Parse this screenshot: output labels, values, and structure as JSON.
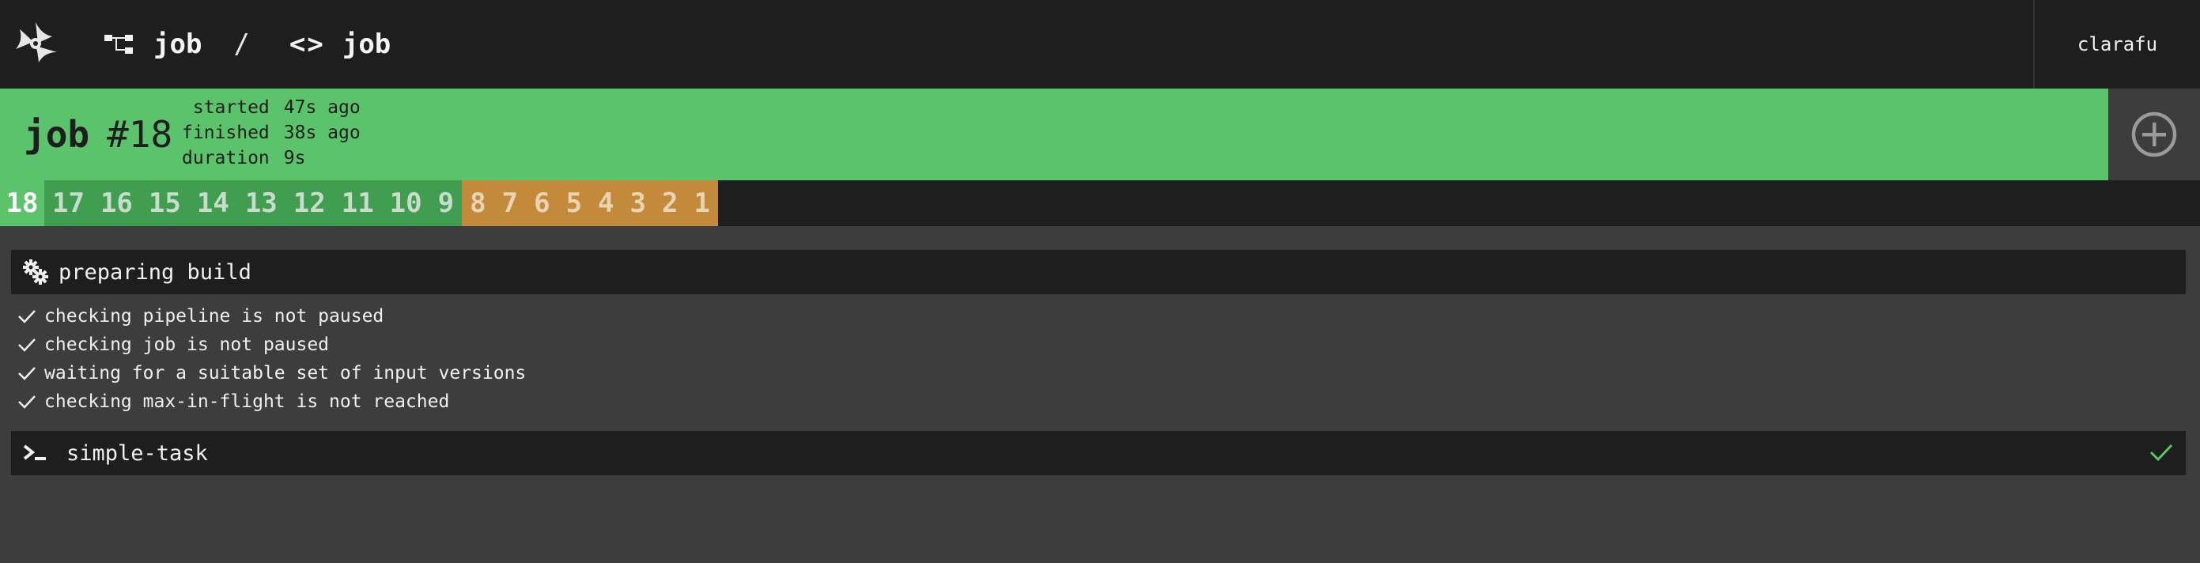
{
  "topbar": {
    "pipeline_name": "job",
    "separator": "/",
    "job_icon": "<>",
    "job_name": "job",
    "user": "clarafu",
    "icons": {
      "logo": "concourse-logo-icon",
      "pipeline": "pipeline-icon",
      "job": "code-brackets-icon"
    }
  },
  "build": {
    "job_name": "job",
    "number": "#18",
    "status": "succeeded",
    "times": [
      {
        "label": "started",
        "value": "47s ago"
      },
      {
        "label": "finished",
        "value": "38s ago"
      },
      {
        "label": "duration",
        "value": "9s"
      }
    ],
    "trigger_icon": "add-circle-icon"
  },
  "build_tabs": [
    {
      "label": "18",
      "status": "current"
    },
    {
      "label": "17",
      "status": "succeeded"
    },
    {
      "label": "16",
      "status": "succeeded"
    },
    {
      "label": "15",
      "status": "succeeded"
    },
    {
      "label": "14",
      "status": "succeeded"
    },
    {
      "label": "13",
      "status": "succeeded"
    },
    {
      "label": "12",
      "status": "succeeded"
    },
    {
      "label": "11",
      "status": "succeeded"
    },
    {
      "label": "10",
      "status": "succeeded"
    },
    {
      "label": "9",
      "status": "succeeded"
    },
    {
      "label": "8",
      "status": "errored"
    },
    {
      "label": "7",
      "status": "errored"
    },
    {
      "label": "6",
      "status": "errored"
    },
    {
      "label": "5",
      "status": "errored"
    },
    {
      "label": "4",
      "status": "errored"
    },
    {
      "label": "3",
      "status": "errored"
    },
    {
      "label": "2",
      "status": "errored"
    },
    {
      "label": "1",
      "status": "errored"
    }
  ],
  "preparing": {
    "title": "preparing build",
    "icon": "gears-icon",
    "checks": [
      "checking pipeline is not paused",
      "checking job is not paused",
      "waiting for a suitable set of input versions",
      "checking max-in-flight is not reached"
    ]
  },
  "task": {
    "name": "simple-task",
    "icon": "terminal-icon",
    "status_icon": "check-icon"
  },
  "colors": {
    "succeeded": "#5cc36d",
    "succeeded_dark": "#419e51",
    "errored": "#c38a3c",
    "bar": "#1e1e1e",
    "background": "#3d3d3d"
  }
}
